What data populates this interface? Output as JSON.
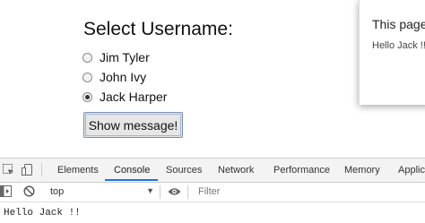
{
  "page": {
    "heading": "Select Username:",
    "options": [
      {
        "label": "Jim Tyler",
        "checked": false
      },
      {
        "label": "John Ivy",
        "checked": false
      },
      {
        "label": "Jack Harper",
        "checked": true
      }
    ],
    "button_label": "Show message!"
  },
  "dialog": {
    "title": "This page",
    "message": "Hello Jack !!"
  },
  "devtools": {
    "tabs": [
      "Elements",
      "Console",
      "Sources",
      "Network",
      "Performance",
      "Memory",
      "Applic"
    ],
    "active_tab": "Console",
    "accent": "#1a73e8",
    "context": "top",
    "filter_placeholder": "Filter",
    "console_output": "Hello Jack !!",
    "icons": [
      "inspect-icon",
      "device-toggle-icon",
      "sidebar-toggle-icon",
      "clear-console-icon",
      "dropdown-arrow-icon",
      "eye-icon"
    ]
  }
}
